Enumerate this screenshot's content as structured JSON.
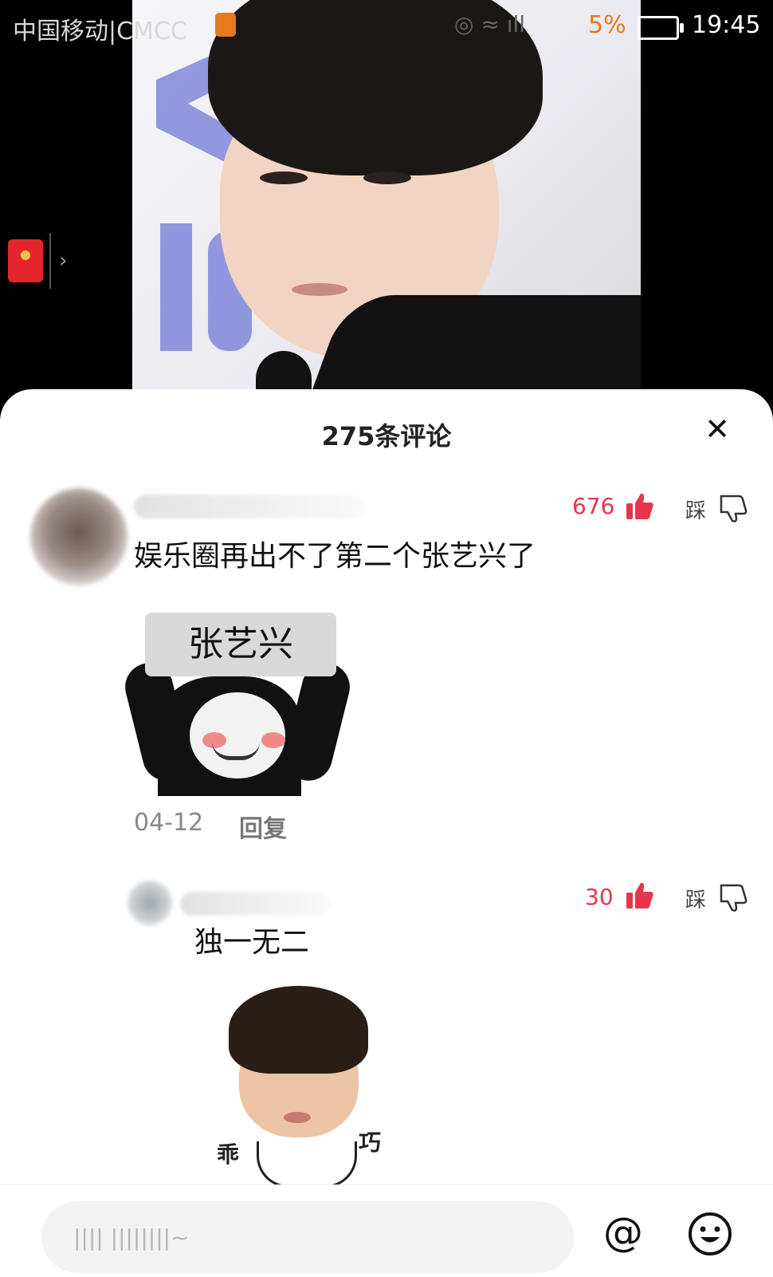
{
  "status_bar": {
    "carrier": "中国移动|CMCC",
    "battery_percent": "5%",
    "time": "19:45"
  },
  "comments_panel": {
    "title": "275条评论"
  },
  "comments": [
    {
      "text": "娱乐圈再出不了第二个张艺兴了",
      "likes": "676",
      "dislike_label": "踩",
      "date": "04-12",
      "reply_label": "回复",
      "sticker_text": "张艺兴"
    },
    {
      "text": "独一无二",
      "likes": "30",
      "dislike_label": "踩",
      "sticker_left_text": "乖",
      "sticker_right_text": "巧"
    }
  ],
  "input": {
    "placeholder": "|||| ||||||||~"
  },
  "colors": {
    "like_accent": "#e7344e",
    "battery_low": "#e8791f",
    "sheet_bg": "#ffffff"
  },
  "icons": [
    "red-packet-icon",
    "close-icon",
    "thumbs-up-icon",
    "thumbs-down-icon",
    "at-icon",
    "emoji-icon"
  ]
}
